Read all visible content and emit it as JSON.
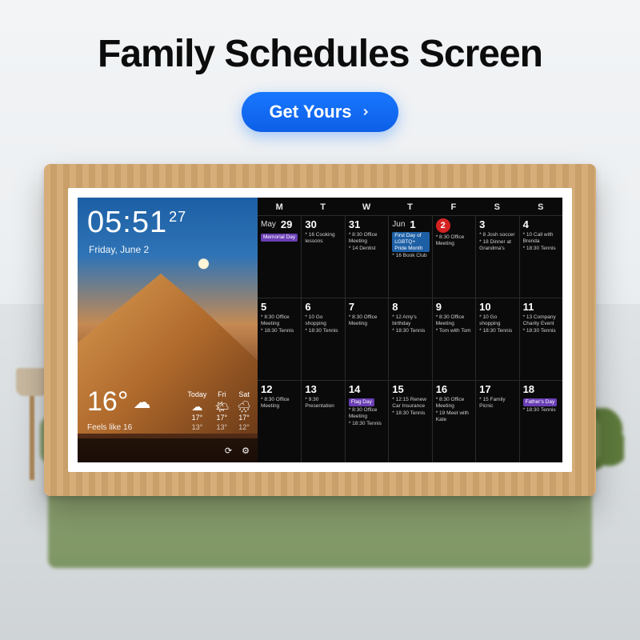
{
  "headline": "Family Schedules Screen",
  "cta_label": "Get Yours",
  "clock": {
    "hm": "05:51",
    "ss": "27"
  },
  "date": "Friday, June 2",
  "weather": {
    "temp": "16°",
    "feels": "Feels like 16",
    "condition_icon": "☁",
    "forecast": [
      {
        "label": "Today",
        "icon": "☁",
        "hi": "17°",
        "lo": "13°"
      },
      {
        "label": "Fri",
        "icon": "🌤",
        "hi": "17°",
        "lo": "13°"
      },
      {
        "label": "Sat",
        "icon": "🌧",
        "hi": "17°",
        "lo": "12°"
      }
    ]
  },
  "bottom_icons": {
    "settings": "⚙",
    "refresh": "⟳"
  },
  "dow": [
    "M",
    "T",
    "W",
    "T",
    "F",
    "S",
    "S"
  ],
  "cells": [
    {
      "month": "May",
      "day": "29",
      "events": [],
      "tag": {
        "text": "Memorial Day",
        "cls": "purple"
      }
    },
    {
      "month": "",
      "day": "30",
      "events": [
        "* 16 Cooking lessons"
      ]
    },
    {
      "month": "",
      "day": "31",
      "events": [
        "* 8:30 Office Meeting",
        "* 14 Dentist"
      ]
    },
    {
      "month": "Jun",
      "day": "1",
      "events": [
        "* 16 Book Club"
      ],
      "tag": {
        "text": "First Day of LGBTQ+ Pride Month",
        "cls": "blue"
      }
    },
    {
      "month": "",
      "day": "2",
      "today": true,
      "events": [
        "* 8:30 Office Meeting"
      ]
    },
    {
      "month": "",
      "day": "3",
      "events": [
        "* 8 Josh soccer",
        "* 18 Dinner at Grandma's"
      ]
    },
    {
      "month": "",
      "day": "4",
      "events": [
        "* 10 Call with Brenda",
        "* 18:30 Tennis"
      ]
    },
    {
      "month": "",
      "day": "5",
      "events": [
        "* 8:30 Office Meeting",
        "* 18:30 Tennis"
      ]
    },
    {
      "month": "",
      "day": "6",
      "events": [
        "* 10 Go shopping",
        "* 18:30 Tennis"
      ]
    },
    {
      "month": "",
      "day": "7",
      "events": [
        "* 8:30 Office Meeting"
      ]
    },
    {
      "month": "",
      "day": "8",
      "events": [
        "* 12 Amy's birthday",
        "* 18:30 Tennis"
      ]
    },
    {
      "month": "",
      "day": "9",
      "events": [
        "* 8:30 Office Meeting",
        "* Tom with Tom"
      ]
    },
    {
      "month": "",
      "day": "10",
      "events": [
        "* 10 Go shopping",
        "* 18:30 Tennis"
      ]
    },
    {
      "month": "",
      "day": "11",
      "events": [
        "* 13 Company Charity Event",
        "* 18:30 Tennis"
      ]
    },
    {
      "month": "",
      "day": "12",
      "events": [
        "* 8:30 Office Meeting"
      ]
    },
    {
      "month": "",
      "day": "13",
      "events": [
        "* 9:30 Presentation"
      ]
    },
    {
      "month": "",
      "day": "14",
      "events": [
        "* 8:30 Office Meeting",
        "* 18:30 Tennis"
      ],
      "tag": {
        "text": "Flag Day",
        "cls": "purple"
      }
    },
    {
      "month": "",
      "day": "15",
      "events": [
        "* 12:15 Renew Car Insurance",
        "* 18:30 Tennis"
      ]
    },
    {
      "month": "",
      "day": "16",
      "events": [
        "* 8:30 Office Meeting",
        "* 19 Meet with Kate"
      ]
    },
    {
      "month": "",
      "day": "17",
      "events": [
        "* 15 Family Picnic"
      ]
    },
    {
      "month": "",
      "day": "18",
      "events": [
        "* 18:30 Tennis"
      ],
      "tag": {
        "text": "Father's Day",
        "cls": "purple"
      }
    }
  ]
}
